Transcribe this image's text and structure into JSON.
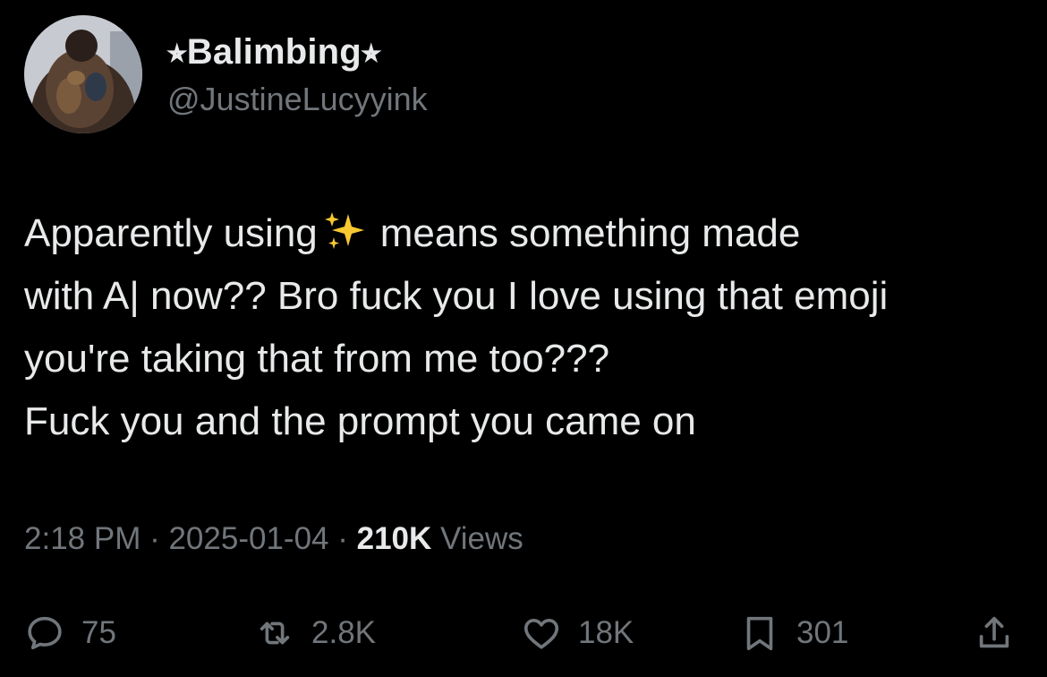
{
  "author": {
    "display_name": "⭒Balimbing⭒",
    "handle": "@JustineLucyyink",
    "avatar_icon": "avatar-photo"
  },
  "tweet": {
    "line1_before": "Apparently using",
    "line1_emoji": "sparkles-emoji",
    "line1_after": "means something made",
    "line2": "with A| now?? Bro fuck you I love using that emoji",
    "line3": "you're taking that from me too???",
    "line4": "Fuck you and the prompt you came on"
  },
  "meta": {
    "time": "2:18 PM",
    "separator": " · ",
    "date": "2025-01-04",
    "views_count": "210K",
    "views_label": " Views"
  },
  "actions": {
    "replies": "75",
    "reposts": "2.8K",
    "likes": "18K",
    "bookmarks": "301"
  },
  "colors": {
    "background": "#000000",
    "text": "#e7e9ea",
    "muted": "#71767b",
    "sparkle": "#f8c831"
  }
}
